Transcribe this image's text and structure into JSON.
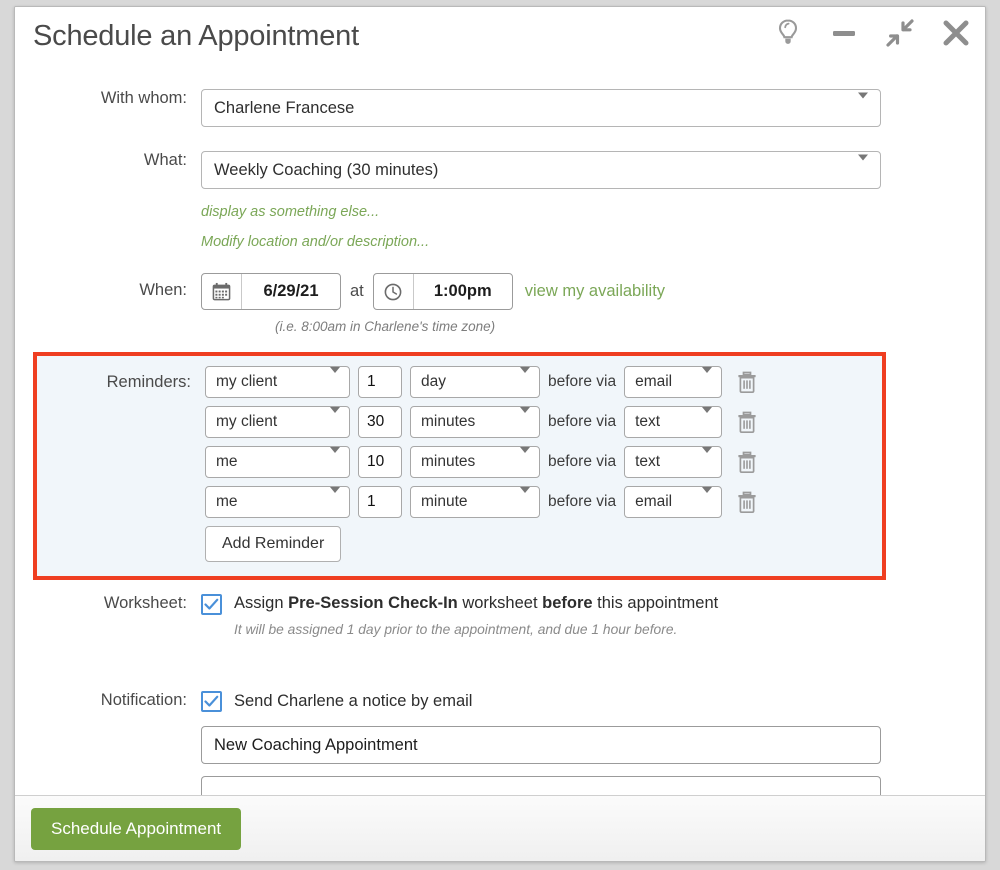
{
  "window": {
    "title": "Schedule an Appointment",
    "controls": [
      {
        "name": "tips-lightbulb",
        "icon": "lightbulb-icon"
      },
      {
        "name": "minimize",
        "icon": "minimize-icon"
      },
      {
        "name": "collapse",
        "icon": "collapse-icon"
      },
      {
        "name": "close",
        "icon": "close-icon"
      }
    ]
  },
  "form": {
    "with_whom": {
      "label": "With whom:",
      "value": "Charlene Francese"
    },
    "what": {
      "label": "What:",
      "value": "Weekly Coaching (30 minutes)"
    },
    "links": {
      "display_as": "display as something else...",
      "modify_location": "Modify location and/or description..."
    },
    "when": {
      "label": "When:",
      "date": "6/29/21",
      "at": "at",
      "time": "1:00pm",
      "availability_link": "view my availability",
      "timezone_note": "(i.e. 8:00am in Charlene's time zone)"
    },
    "reminders": {
      "label": "Reminders:",
      "before_via": "before via",
      "add_button": "Add Reminder",
      "rows": [
        {
          "who": "my client",
          "amount": "1",
          "unit": "day",
          "via": "email"
        },
        {
          "who": "my client",
          "amount": "30",
          "unit": "minutes",
          "via": "text"
        },
        {
          "who": "me",
          "amount": "10",
          "unit": "minutes",
          "via": "text"
        },
        {
          "who": "me",
          "amount": "1",
          "unit": "minute",
          "via": "email"
        }
      ]
    },
    "worksheet": {
      "label": "Worksheet:",
      "checked": true,
      "text_pre": "Assign ",
      "text_bold1": "Pre-Session Check-In",
      "text_mid": " worksheet ",
      "text_bold2": "before",
      "text_post": " this appointment",
      "note": "It will be assigned 1 day prior to the appointment, and due 1 hour before."
    },
    "notification": {
      "label": "Notification:",
      "checked": true,
      "text": "Send Charlene a notice by email",
      "subject_value": "New Coaching Appointment"
    }
  },
  "footer": {
    "submit_label": "Schedule Appointment"
  },
  "colors": {
    "accent_green": "#76a240",
    "link_green": "#7ba757",
    "highlight_red": "#ef3e21",
    "highlight_bg": "#f1f6fa",
    "checkbox_blue": "#4a90d9"
  }
}
